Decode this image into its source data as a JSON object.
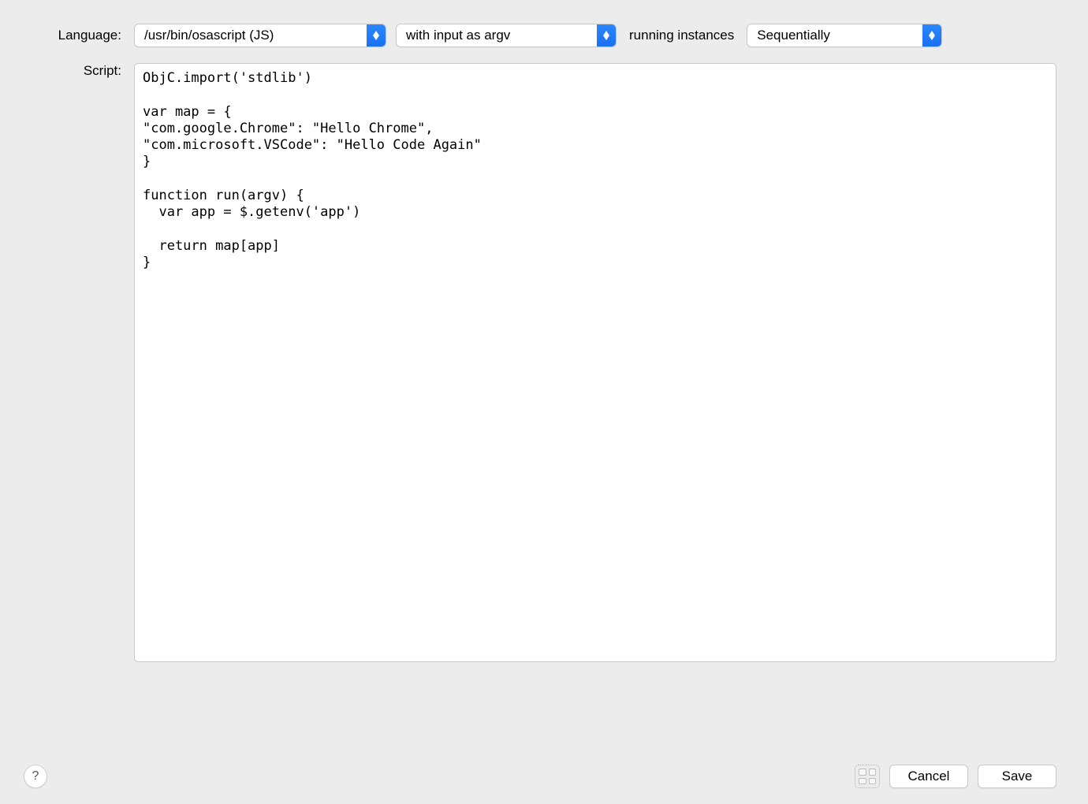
{
  "labels": {
    "language": "Language:",
    "script": "Script:",
    "running_instances": "running instances"
  },
  "selects": {
    "language": "/usr/bin/osascript (JS)",
    "input_mode": "with input as argv",
    "instances": "Sequentially"
  },
  "script_content": "ObjC.import('stdlib')\n\nvar map = {\n\"com.google.Chrome\": \"Hello Chrome\",\n\"com.microsoft.VSCode\": \"Hello Code Again\"\n}\n\nfunction run(argv) {\n  var app = $.getenv('app')\n\n  return map[app]\n}",
  "buttons": {
    "help": "?",
    "cancel": "Cancel",
    "save": "Save"
  }
}
